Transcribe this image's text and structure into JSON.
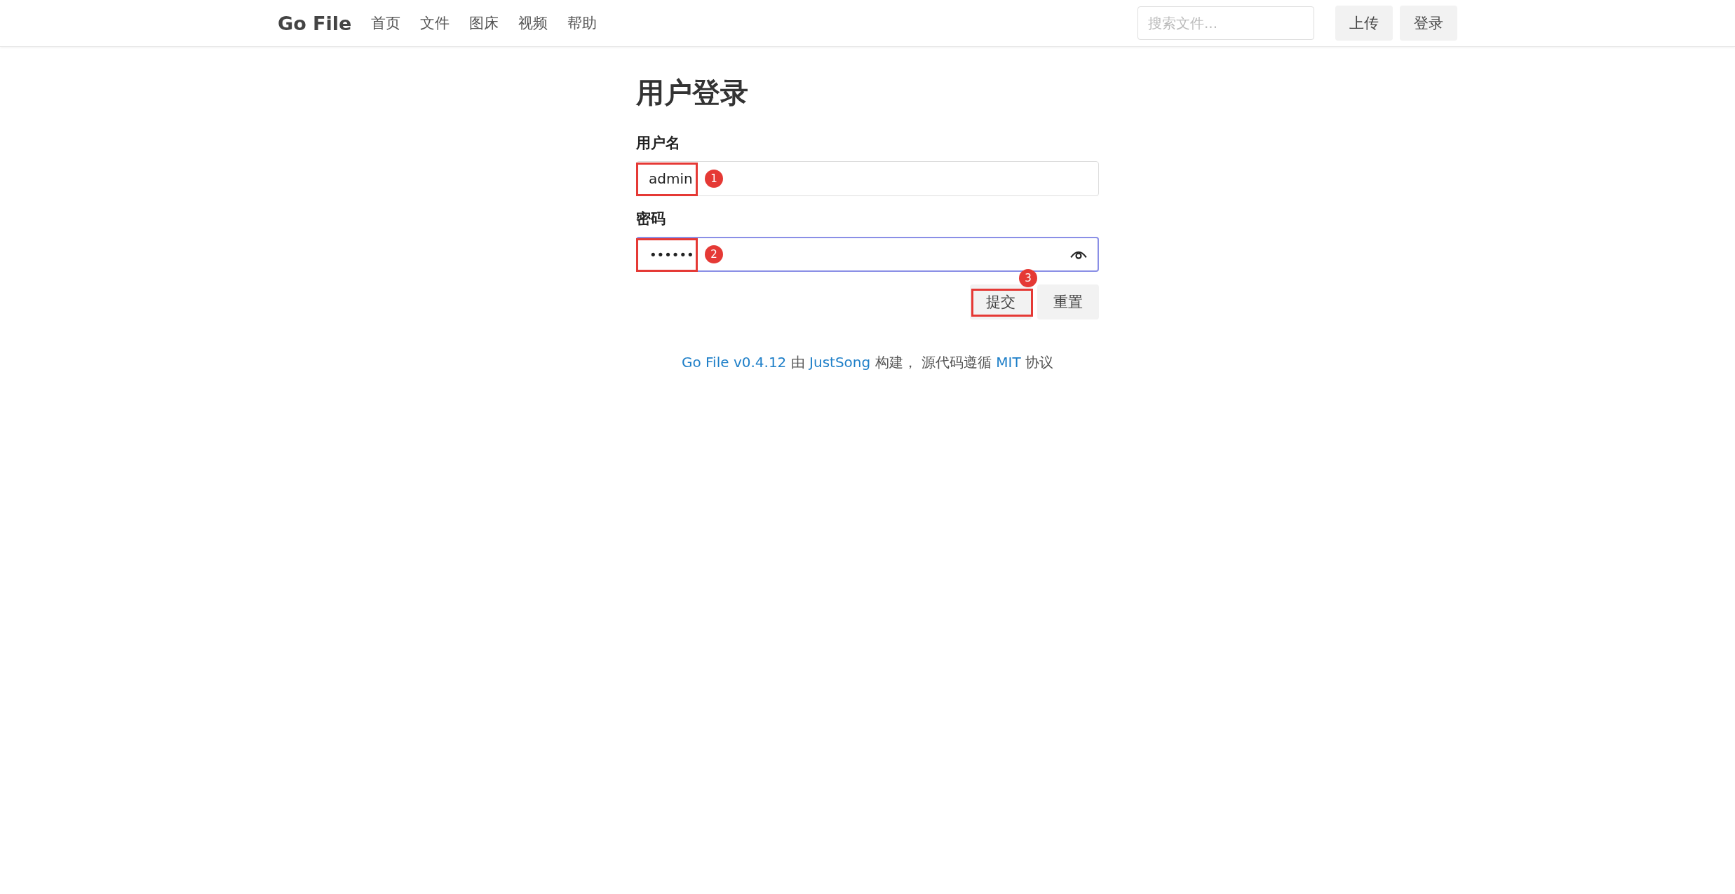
{
  "navbar": {
    "brand": "Go File",
    "links": [
      "首页",
      "文件",
      "图床",
      "视频",
      "帮助"
    ],
    "search": {
      "placeholder": "搜索文件..."
    },
    "buttons": [
      "上传",
      "登录"
    ]
  },
  "login": {
    "title": "用户登录",
    "fields": [
      {
        "kind": "text",
        "label": "用户名",
        "value": "admin",
        "focused": false,
        "callout": "1"
      },
      {
        "kind": "password",
        "label": "密码",
        "value": "••••••",
        "focused": true,
        "callout": "2"
      }
    ],
    "buttons": [
      {
        "label": "提交",
        "callout": "3"
      },
      {
        "label": "重置"
      }
    ]
  },
  "footer": {
    "parts": [
      {
        "kind": "link",
        "text": "Go File v0.4.12"
      },
      {
        "kind": "text",
        "text": " 由 "
      },
      {
        "kind": "link",
        "text": "JustSong"
      },
      {
        "kind": "text",
        "text": " 构建， 源代码遵循 "
      },
      {
        "kind": "link",
        "text": "MIT"
      },
      {
        "kind": "text",
        "text": " 协议"
      }
    ]
  }
}
